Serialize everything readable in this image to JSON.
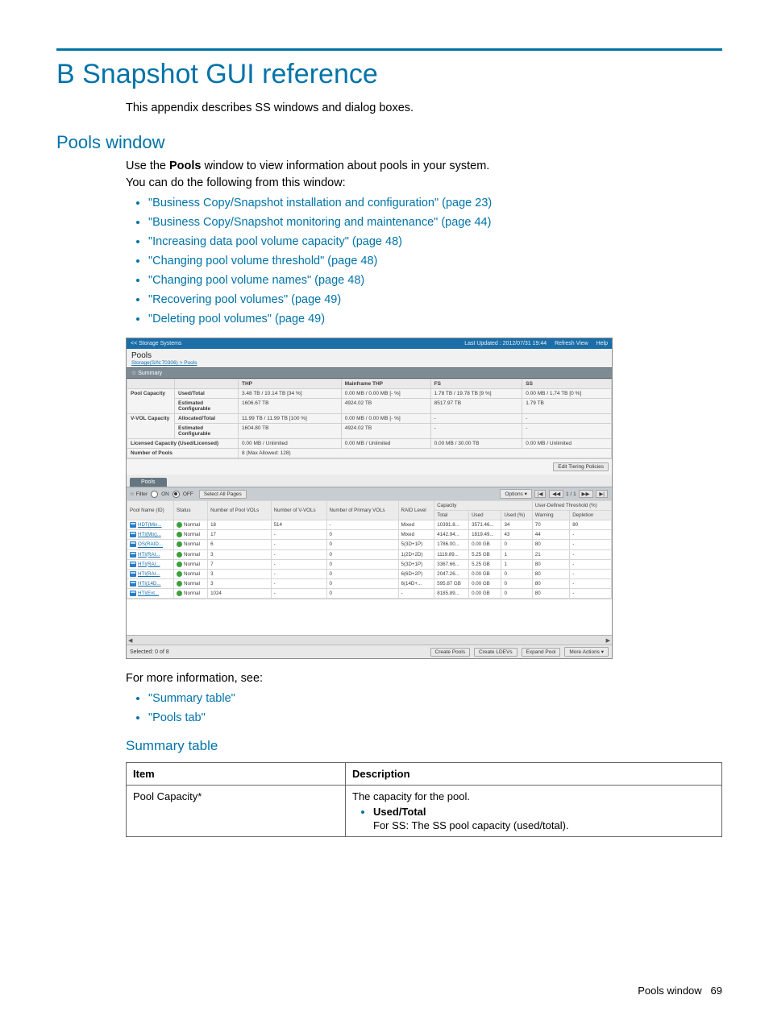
{
  "page": {
    "title": "B Snapshot GUI reference",
    "intro": "This appendix describes SS windows and dialog boxes.",
    "section_pools": "Pools window",
    "pools_intro1_prefix": "Use the ",
    "pools_intro1_bold": "Pools",
    "pools_intro1_suffix": " window to view information about pools in your system.",
    "pools_intro2": "You can do the following from this window:",
    "links": [
      "\"Business Copy/Snapshot installation and configuration\" (page 23)",
      "\"Business Copy/Snapshot monitoring and maintenance\" (page 44)",
      "\"Increasing data pool volume capacity\" (page 48)",
      "\"Changing pool volume threshold\" (page 48)",
      "\"Changing pool volume names\" (page 48)",
      "\"Recovering pool volumes\" (page 49)",
      "\"Deleting pool volumes\" (page 49)"
    ],
    "more_info": "For more information, see:",
    "see_links": [
      "\"Summary table\"",
      "\"Pools tab\""
    ],
    "subsection_summary": "Summary table",
    "doc_th_item": "Item",
    "doc_th_desc": "Description",
    "doc_row_item": "Pool Capacity*",
    "doc_row_desc_line1": "The capacity for the pool.",
    "doc_row_desc_bullet": "Used/Total",
    "doc_row_desc_line2": "For SS: The SS pool capacity (used/total).",
    "footer_label": "Pools window",
    "footer_page": "69"
  },
  "shot": {
    "top_left": "<< Storage Systems",
    "top_updated": "Last Updated : 2012/07/31 19:44",
    "top_refresh": "Refresh View",
    "top_help": "Help",
    "title": "Pools",
    "breadcrumb": "Storage(S/N:70306) > Pools",
    "summary_header": "☆  Summary",
    "sum_cols": [
      "THP",
      "Mainframe THP",
      "FS",
      "SS"
    ],
    "sum_rows": {
      "pool_cap": {
        "label": "Pool Capacity",
        "type1": "Used/Total",
        "cells1": [
          "3.48 TB / 10.14 TB\n[34 %]",
          "0.00 MB / 0.00 MB\n[- %]",
          "1.78 TB / 19.78 TB\n[9 %]",
          "0.00 MB / 1.74 TB\n[0 %]"
        ],
        "type2": "Estimated Configurable",
        "cells2": [
          "1606.67 TB",
          "4924.02 TB",
          "8517.97 TB",
          "1.79 TB"
        ]
      },
      "vvol_cap": {
        "label": "V-VOL Capacity",
        "type1": "Allocated/Total",
        "cells1": [
          "11.99 TB / 11.99 TB\n[100 %]",
          "0.00 MB / 0.00 MB\n[- %]",
          "-",
          "-"
        ],
        "type2": "Estimated Configurable",
        "cells2": [
          "1604.80 TB",
          "4924.02 TB",
          "-",
          "-"
        ]
      },
      "licensed": {
        "label": "Licensed Capacity (Used/Licensed)",
        "cells": [
          "0.00 MB / Unlimited",
          "0.00 MB / Unlimited",
          "0.00 MB / 30.00 TB",
          "0.00 MB / Unlimited"
        ]
      },
      "numpools": {
        "label": "Number of Pools",
        "cells": [
          "8 (Max Allowed: 128)",
          "",
          "",
          ""
        ]
      }
    },
    "edit_tiering": "Edit Tiering Policies",
    "pools_tab": "Pools",
    "filter_label": "☆ Filter",
    "filter_on": "ON",
    "filter_off": "OFF",
    "select_all": "Select All Pages",
    "options_label": "Options ▾",
    "page_current": "1",
    "page_total": "/ 1",
    "headers": {
      "pool_name": "Pool Name\n(ID)",
      "status": "Status",
      "num_pool_vols": "Number of\nPool VOLs",
      "num_vvols": "Number of\nV-VOLs",
      "num_primary": "Number of\nPrimary VOLs",
      "raid": "RAID\nLevel",
      "cap_group": "Capacity",
      "cap_total": "Total",
      "cap_used": "Used",
      "cap_used_pct": "Used (%)",
      "thr_group": "User-Defined Threshold (%)",
      "thr_warn": "Warning",
      "thr_dep": "Depletion"
    },
    "rows": [
      {
        "name": "HDT(Mix...",
        "status": "Normal",
        "pool_vols": "18",
        "vvols": "514",
        "primary": "-",
        "raid": "Mixed",
        "total": "10391.8...",
        "used": "3571.46...",
        "used_pct": "34",
        "warn": "70",
        "dep": "80"
      },
      {
        "name": "HTI(Mix)...",
        "status": "Normal",
        "pool_vols": "17",
        "vvols": "-",
        "primary": "0",
        "raid": "Mixed",
        "total": "4142.94...",
        "used": "1819.49...",
        "used_pct": "43",
        "warn": "44",
        "dep": "-"
      },
      {
        "name": "OS(RAID...",
        "status": "Normal",
        "pool_vols": "6",
        "vvols": "-",
        "primary": "0",
        "raid": "5(3D+1P)",
        "total": "1786.00...",
        "used": "0.00 GB",
        "used_pct": "0",
        "warn": "80",
        "dep": "-"
      },
      {
        "name": "HTI(RAI...",
        "status": "Normal",
        "pool_vols": "3",
        "vvols": "-",
        "primary": "0",
        "raid": "1(2D+2D)",
        "total": "1119.89...",
        "used": "5.25 GB",
        "used_pct": "1",
        "warn": "21",
        "dep": "-"
      },
      {
        "name": "HTI(RAI...",
        "status": "Normal",
        "pool_vols": "7",
        "vvols": "-",
        "primary": "0",
        "raid": "5(3D+1P)",
        "total": "3367.66...",
        "used": "5.25 GB",
        "used_pct": "1",
        "warn": "80",
        "dep": "-"
      },
      {
        "name": "HTI(RAI...",
        "status": "Normal",
        "pool_vols": "3",
        "vvols": "-",
        "primary": "0",
        "raid": "6(6D+2P)",
        "total": "2047.26...",
        "used": "0.00 GB",
        "used_pct": "0",
        "warn": "80",
        "dep": "-"
      },
      {
        "name": "HTI(14D...",
        "status": "Normal",
        "pool_vols": "3",
        "vvols": "-",
        "primary": "0",
        "raid": "6(14D+...",
        "total": "595.87 GB",
        "used": "0.00 GB",
        "used_pct": "0",
        "warn": "80",
        "dep": "-"
      },
      {
        "name": "HTI(Ext...",
        "status": "Normal",
        "pool_vols": "1024",
        "vvols": "-",
        "primary": "0",
        "raid": "-",
        "total": "8185.89...",
        "used": "0.00 GB",
        "used_pct": "0",
        "warn": "80",
        "dep": "-"
      }
    ],
    "selected_label": "Selected:  0   of   8",
    "btn_create_pools": "Create Pools",
    "btn_create_ldevs": "Create LDEVs",
    "btn_expand_pool": "Expand Pool",
    "btn_more_actions": "More Actions ▾"
  }
}
